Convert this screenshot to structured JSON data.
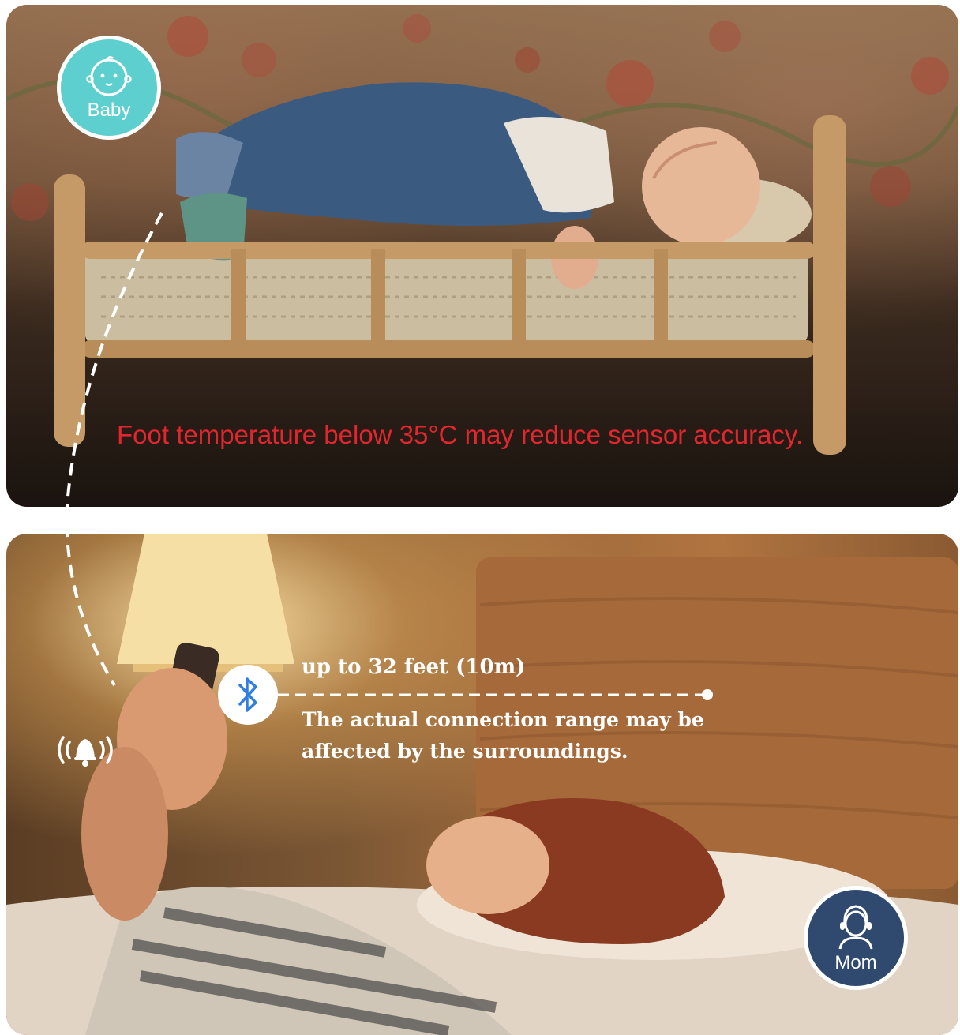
{
  "top_panel": {
    "badge_label": "Baby",
    "warning_text": "Foot temperature below 35°C may reduce sensor accuracy.",
    "colors": {
      "badge": "#5ecfcf",
      "warning": "#e0262e"
    }
  },
  "bottom_panel": {
    "range_title": "up to 32 feet (10m)",
    "range_note": "The actual connection range may be affected by the surroundings.",
    "badge_label": "Mom",
    "colors": {
      "badge": "#2f4a6e",
      "bluetooth": "#2f7de1"
    }
  },
  "icons": [
    "baby-face-icon",
    "bluetooth-icon",
    "alarm-bell-icon",
    "mom-avatar-icon"
  ]
}
